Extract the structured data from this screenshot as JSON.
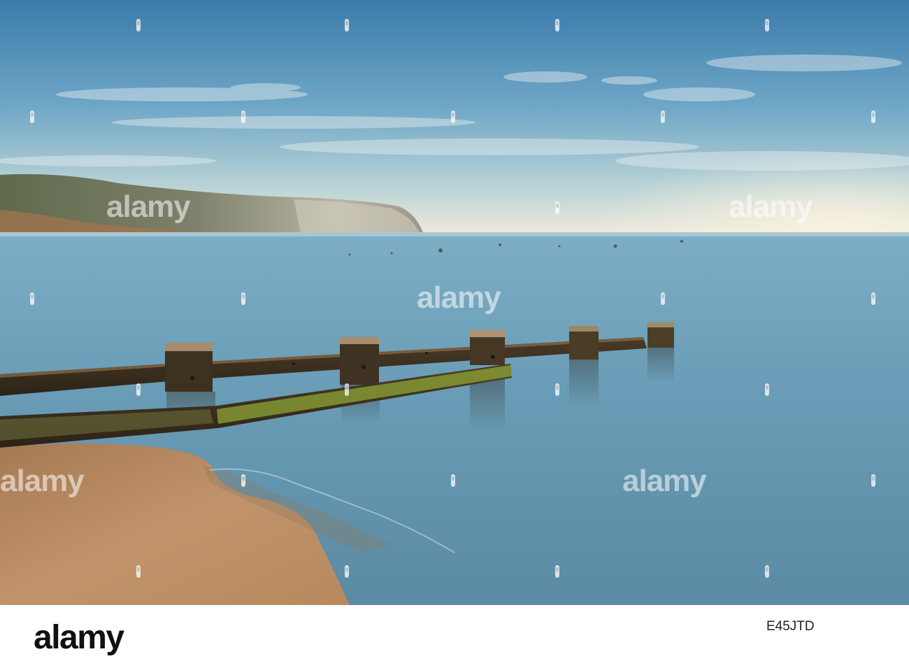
{
  "watermark": {
    "brand": "alamy"
  },
  "footer": {
    "logo": "alamy",
    "image_id": "E45JTD"
  },
  "colors": {
    "sky_top": "#3f7fae",
    "sky_horizon": "#f1ede0",
    "sea": "#6f9fb8",
    "sand": "#b98a5e",
    "wood": "#3a2e1e",
    "algae": "#8ea536",
    "cliff": "#8a8470"
  }
}
